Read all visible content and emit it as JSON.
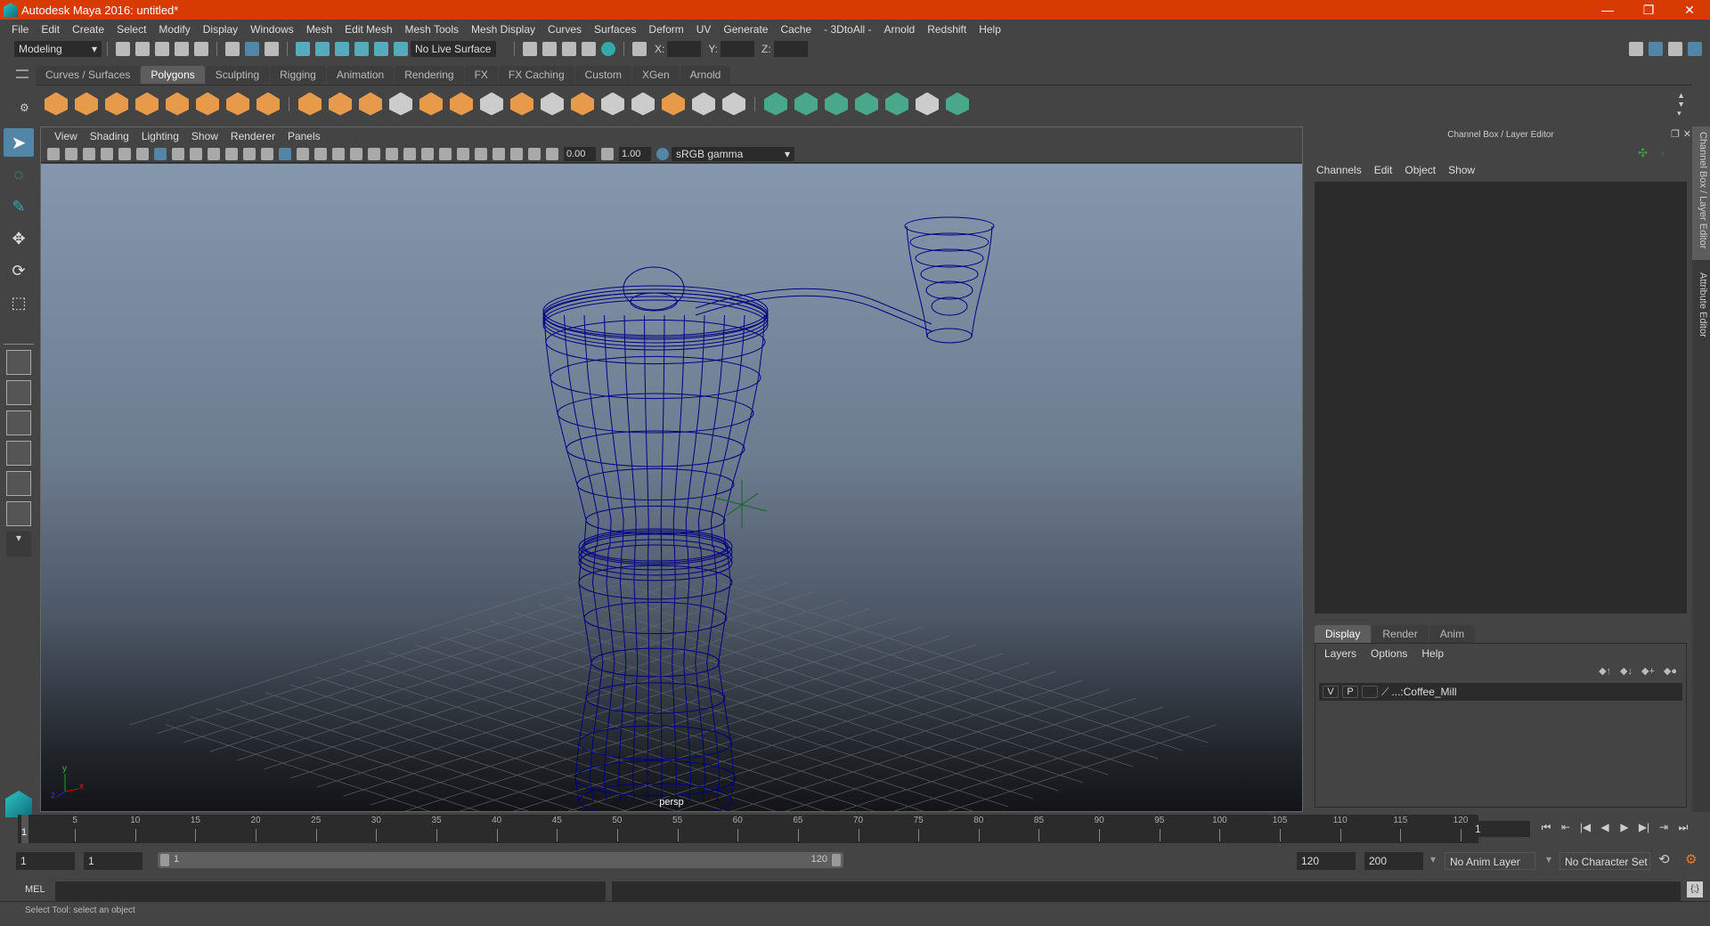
{
  "window": {
    "title": "Autodesk Maya 2016: untitled*",
    "minimize": "—",
    "restore": "❐",
    "close": "✕"
  },
  "menubar": [
    "File",
    "Edit",
    "Create",
    "Select",
    "Modify",
    "Display",
    "Windows",
    "Mesh",
    "Edit Mesh",
    "Mesh Tools",
    "Mesh Display",
    "Curves",
    "Surfaces",
    "Deform",
    "UV",
    "Generate",
    "Cache",
    "- 3DtoAll -",
    "Arnold",
    "Redshift",
    "Help"
  ],
  "statusline": {
    "menu_set": "Modeling",
    "live_surface": "No Live Surface",
    "x_label": "X:",
    "y_label": "Y:",
    "z_label": "Z:",
    "x": "",
    "y": "",
    "z": ""
  },
  "shelf": {
    "tabs": [
      "Curves / Surfaces",
      "Polygons",
      "Sculpting",
      "Rigging",
      "Animation",
      "Rendering",
      "FX",
      "FX Caching",
      "Custom",
      "XGen",
      "Arnold"
    ],
    "active_tab": "Polygons"
  },
  "viewport": {
    "menu": [
      "View",
      "Shading",
      "Lighting",
      "Show",
      "Renderer",
      "Panels"
    ],
    "exposure": "0.00",
    "gamma": "1.00",
    "color_space": "sRGB gamma",
    "camera": "persp",
    "axis": {
      "x": "x",
      "y": "y",
      "z": "z"
    },
    "wire_color": "#000080"
  },
  "channel_box": {
    "title": "Channel Box / Layer Editor",
    "menu": [
      "Channels",
      "Edit",
      "Object",
      "Show"
    ],
    "layer_tabs": [
      "Display",
      "Render",
      "Anim"
    ],
    "active_layer_tab": "Display",
    "layer_menu": [
      "Layers",
      "Options",
      "Help"
    ],
    "layers": [
      {
        "v": "V",
        "p": "P",
        "name": "...:Coffee_Mill"
      }
    ]
  },
  "side_tabs": [
    "Channel Box / Layer Editor",
    "Attribute Editor"
  ],
  "timeline": {
    "ticks": [
      5,
      10,
      15,
      20,
      25,
      30,
      35,
      40,
      45,
      50,
      55,
      60,
      65,
      70,
      75,
      80,
      85,
      90,
      95,
      100,
      105,
      110,
      115,
      120
    ],
    "start": 1,
    "end": 120,
    "current_frame": "1",
    "current_marker": "1"
  },
  "playback": [
    "⏮",
    "⇤",
    "|◀",
    "◀",
    "▶",
    "▶|",
    "⇥",
    "⏭"
  ],
  "range": {
    "start": "1",
    "anim_start": "1",
    "slider_start": "1",
    "slider_end": "120",
    "end": "120",
    "anim_end": "200",
    "anim_layer": "No Anim Layer",
    "character_set": "No Character Set"
  },
  "command": {
    "lang": "MEL",
    "input": "",
    "result": ""
  },
  "help_line": "Select Tool: select an object"
}
